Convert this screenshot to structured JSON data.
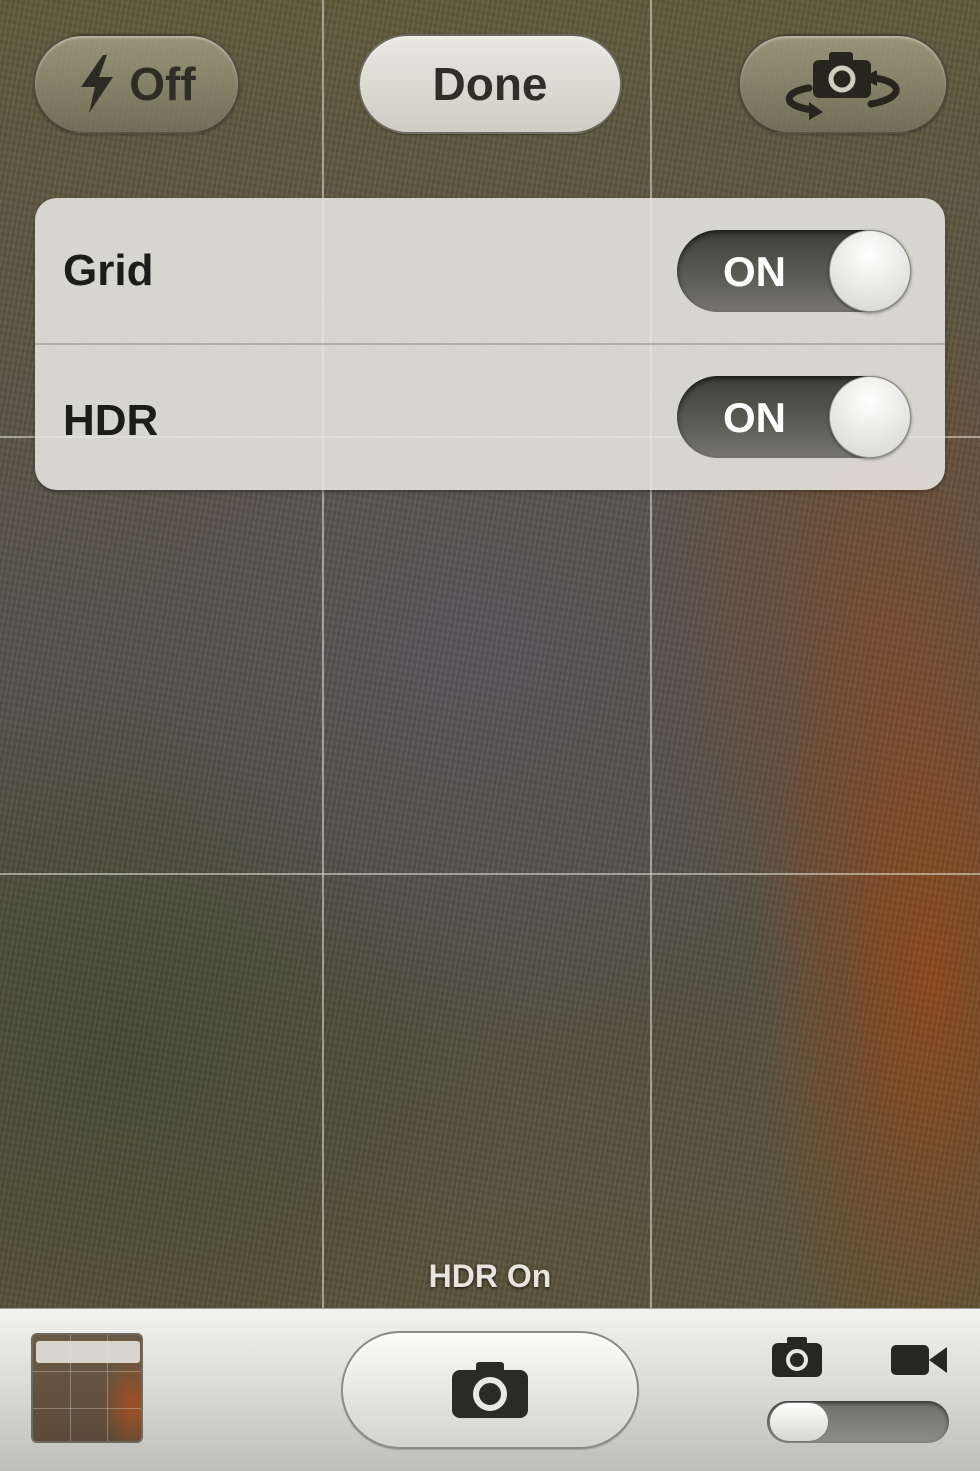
{
  "top_bar": {
    "flash_label": "Off",
    "flash_icon": "lightning-bolt-icon",
    "done_label": "Done",
    "flip_icon": "camera-rotate-icon"
  },
  "options_panel": {
    "rows": [
      {
        "label": "Grid",
        "toggle_label": "ON",
        "state": true
      },
      {
        "label": "HDR",
        "toggle_label": "ON",
        "state": true
      }
    ]
  },
  "viewfinder": {
    "status_text": "HDR On",
    "grid_visible": true
  },
  "toolbar": {
    "thumbnail": "last-photo-thumbnail",
    "shutter_icon": "camera-icon",
    "mode_photo_icon": "camera-icon",
    "mode_video_icon": "video-camera-icon",
    "mode_selected": "photo"
  }
}
